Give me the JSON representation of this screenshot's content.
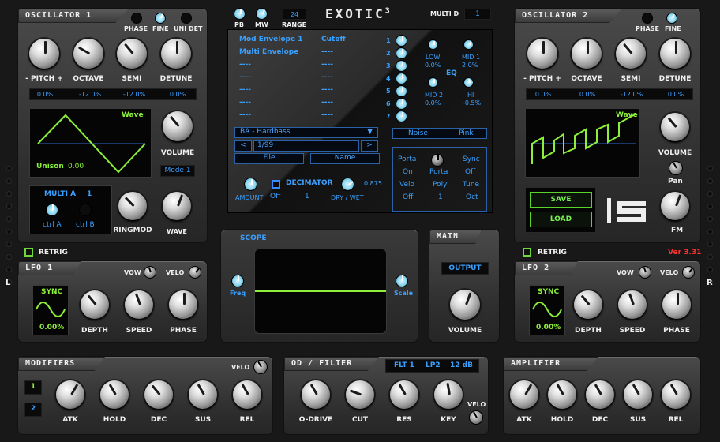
{
  "brand": {
    "name": "EXOTIC",
    "version_sup": "3",
    "version": "Ver 3.31"
  },
  "top": {
    "pb": "PB",
    "mw": "MW",
    "range_value": "24",
    "range_label": "RANGE",
    "multi_d_label": "MULTI D",
    "multi_d_value": "1"
  },
  "side": {
    "left": "L",
    "right": "R"
  },
  "osc1": {
    "title": "OSCILLATOR 1",
    "phase": "PHASE",
    "fine": "FINE",
    "unidet": "UNI DET",
    "knobs": [
      "- PITCH +",
      "OCTAVE",
      "SEMI",
      "DETUNE"
    ],
    "values": [
      "0.0%",
      "-12.0%",
      "-12.0%",
      "0.0%"
    ],
    "wave": "Wave",
    "unison_label": "Unison",
    "unison_value": "0.00",
    "volume": "VOLUME",
    "mode": "Mode 1",
    "multi_label": "MULTI A",
    "multi_value": "1",
    "ctrl_a": "ctrl A",
    "ctrl_b": "ctrl B",
    "ringmod": "RINGMOD",
    "wave_knob": "WAVE",
    "retrig": "RETRIG"
  },
  "osc2": {
    "title": "OSCILLATOR 2",
    "phase": "PHASE",
    "fine": "FINE",
    "knobs": [
      "- PITCH +",
      "OCTAVE",
      "SEMI",
      "DETUNE"
    ],
    "values": [
      "0.0%",
      "0.0%",
      "-12.0%",
      "0.0%"
    ],
    "wave": "Wave",
    "volume": "VOLUME",
    "pan": "Pan",
    "fm": "FM",
    "save": "SAVE",
    "load": "LOAD",
    "retrig": "RETRIG"
  },
  "matrix": {
    "rows": [
      {
        "src": "Mod Envelope 1",
        "dst": "Cutoff"
      },
      {
        "src": "Multi Envelope",
        "dst": "----"
      },
      {
        "src": "----",
        "dst": "----"
      },
      {
        "src": "----",
        "dst": "----"
      },
      {
        "src": "----",
        "dst": "----"
      },
      {
        "src": "----",
        "dst": "----"
      },
      {
        "src": "----",
        "dst": "----"
      }
    ],
    "slots": [
      "1",
      "2",
      "3",
      "4",
      "5",
      "6",
      "7"
    ]
  },
  "eq": {
    "label": "EQ",
    "low": "LOW",
    "low_v": "0.0%",
    "mid1": "MID 1",
    "mid1_v": "2.0%",
    "mid2": "MID 2",
    "mid2_v": "0.0%",
    "hi": "HI",
    "hi_v": "-0.5%"
  },
  "preset": {
    "name": "BA - Hardbass",
    "arrow": "▼",
    "prev": "<",
    "next": ">",
    "index": "1/99",
    "file": "File",
    "name_btn": "Name"
  },
  "noise": {
    "noise": "Noise",
    "pink": "Pink"
  },
  "decimator": {
    "amount": "AMOUNT",
    "off": "Off",
    "label": "DECIMATOR",
    "value": "1",
    "drywet": "DRY / WET",
    "drywet_v": "0.875"
  },
  "voice": {
    "porta": "Porta",
    "on": "On",
    "porta2": "Porta",
    "sync": "Sync",
    "sync_v": "Off",
    "velo": "Velo",
    "velo_v": "Off",
    "poly": "Poly",
    "poly_v": "1",
    "tune": "Tune",
    "tune_v": "Oct"
  },
  "scope": {
    "title": "SCOPE",
    "freq": "Freq",
    "scale": "Scale"
  },
  "main": {
    "title": "MAIN",
    "output": "OUTPUT",
    "volume": "VOLUME"
  },
  "lfo1": {
    "title": "LFO 1",
    "vow": "VOW",
    "velo": "VELO",
    "sync": "SYNC",
    "value": "0.00%",
    "knobs": [
      "DEPTH",
      "SPEED",
      "PHASE"
    ]
  },
  "lfo2": {
    "title": "LFO 2",
    "vow": "VOW",
    "velo": "VELO",
    "sync": "SYNC",
    "value": "0.00%",
    "knobs": [
      "DEPTH",
      "SPEED",
      "PHASE"
    ]
  },
  "modifiers": {
    "title": "MODIFIERS",
    "velo": "VELO",
    "btn1": "1",
    "btn2": "2",
    "knobs": [
      "ATK",
      "HOLD",
      "DEC",
      "SUS",
      "REL"
    ]
  },
  "filter": {
    "title": "OD / FILTER",
    "flt": "FLT 1",
    "type": "LP2",
    "slope": "12 dB",
    "velo": "VELO",
    "knobs": [
      "O-DRIVE",
      "CUT",
      "RES",
      "KEY"
    ]
  },
  "amp": {
    "title": "AMPLIFIER",
    "knobs": [
      "ATK",
      "HOLD",
      "DEC",
      "SUS",
      "REL"
    ]
  },
  "colors": {
    "accent_blue": "#3aa0ff",
    "wave_green": "#8cf03a",
    "cyan_knob": "#8cd8f0",
    "red_version": "#ff3030"
  }
}
